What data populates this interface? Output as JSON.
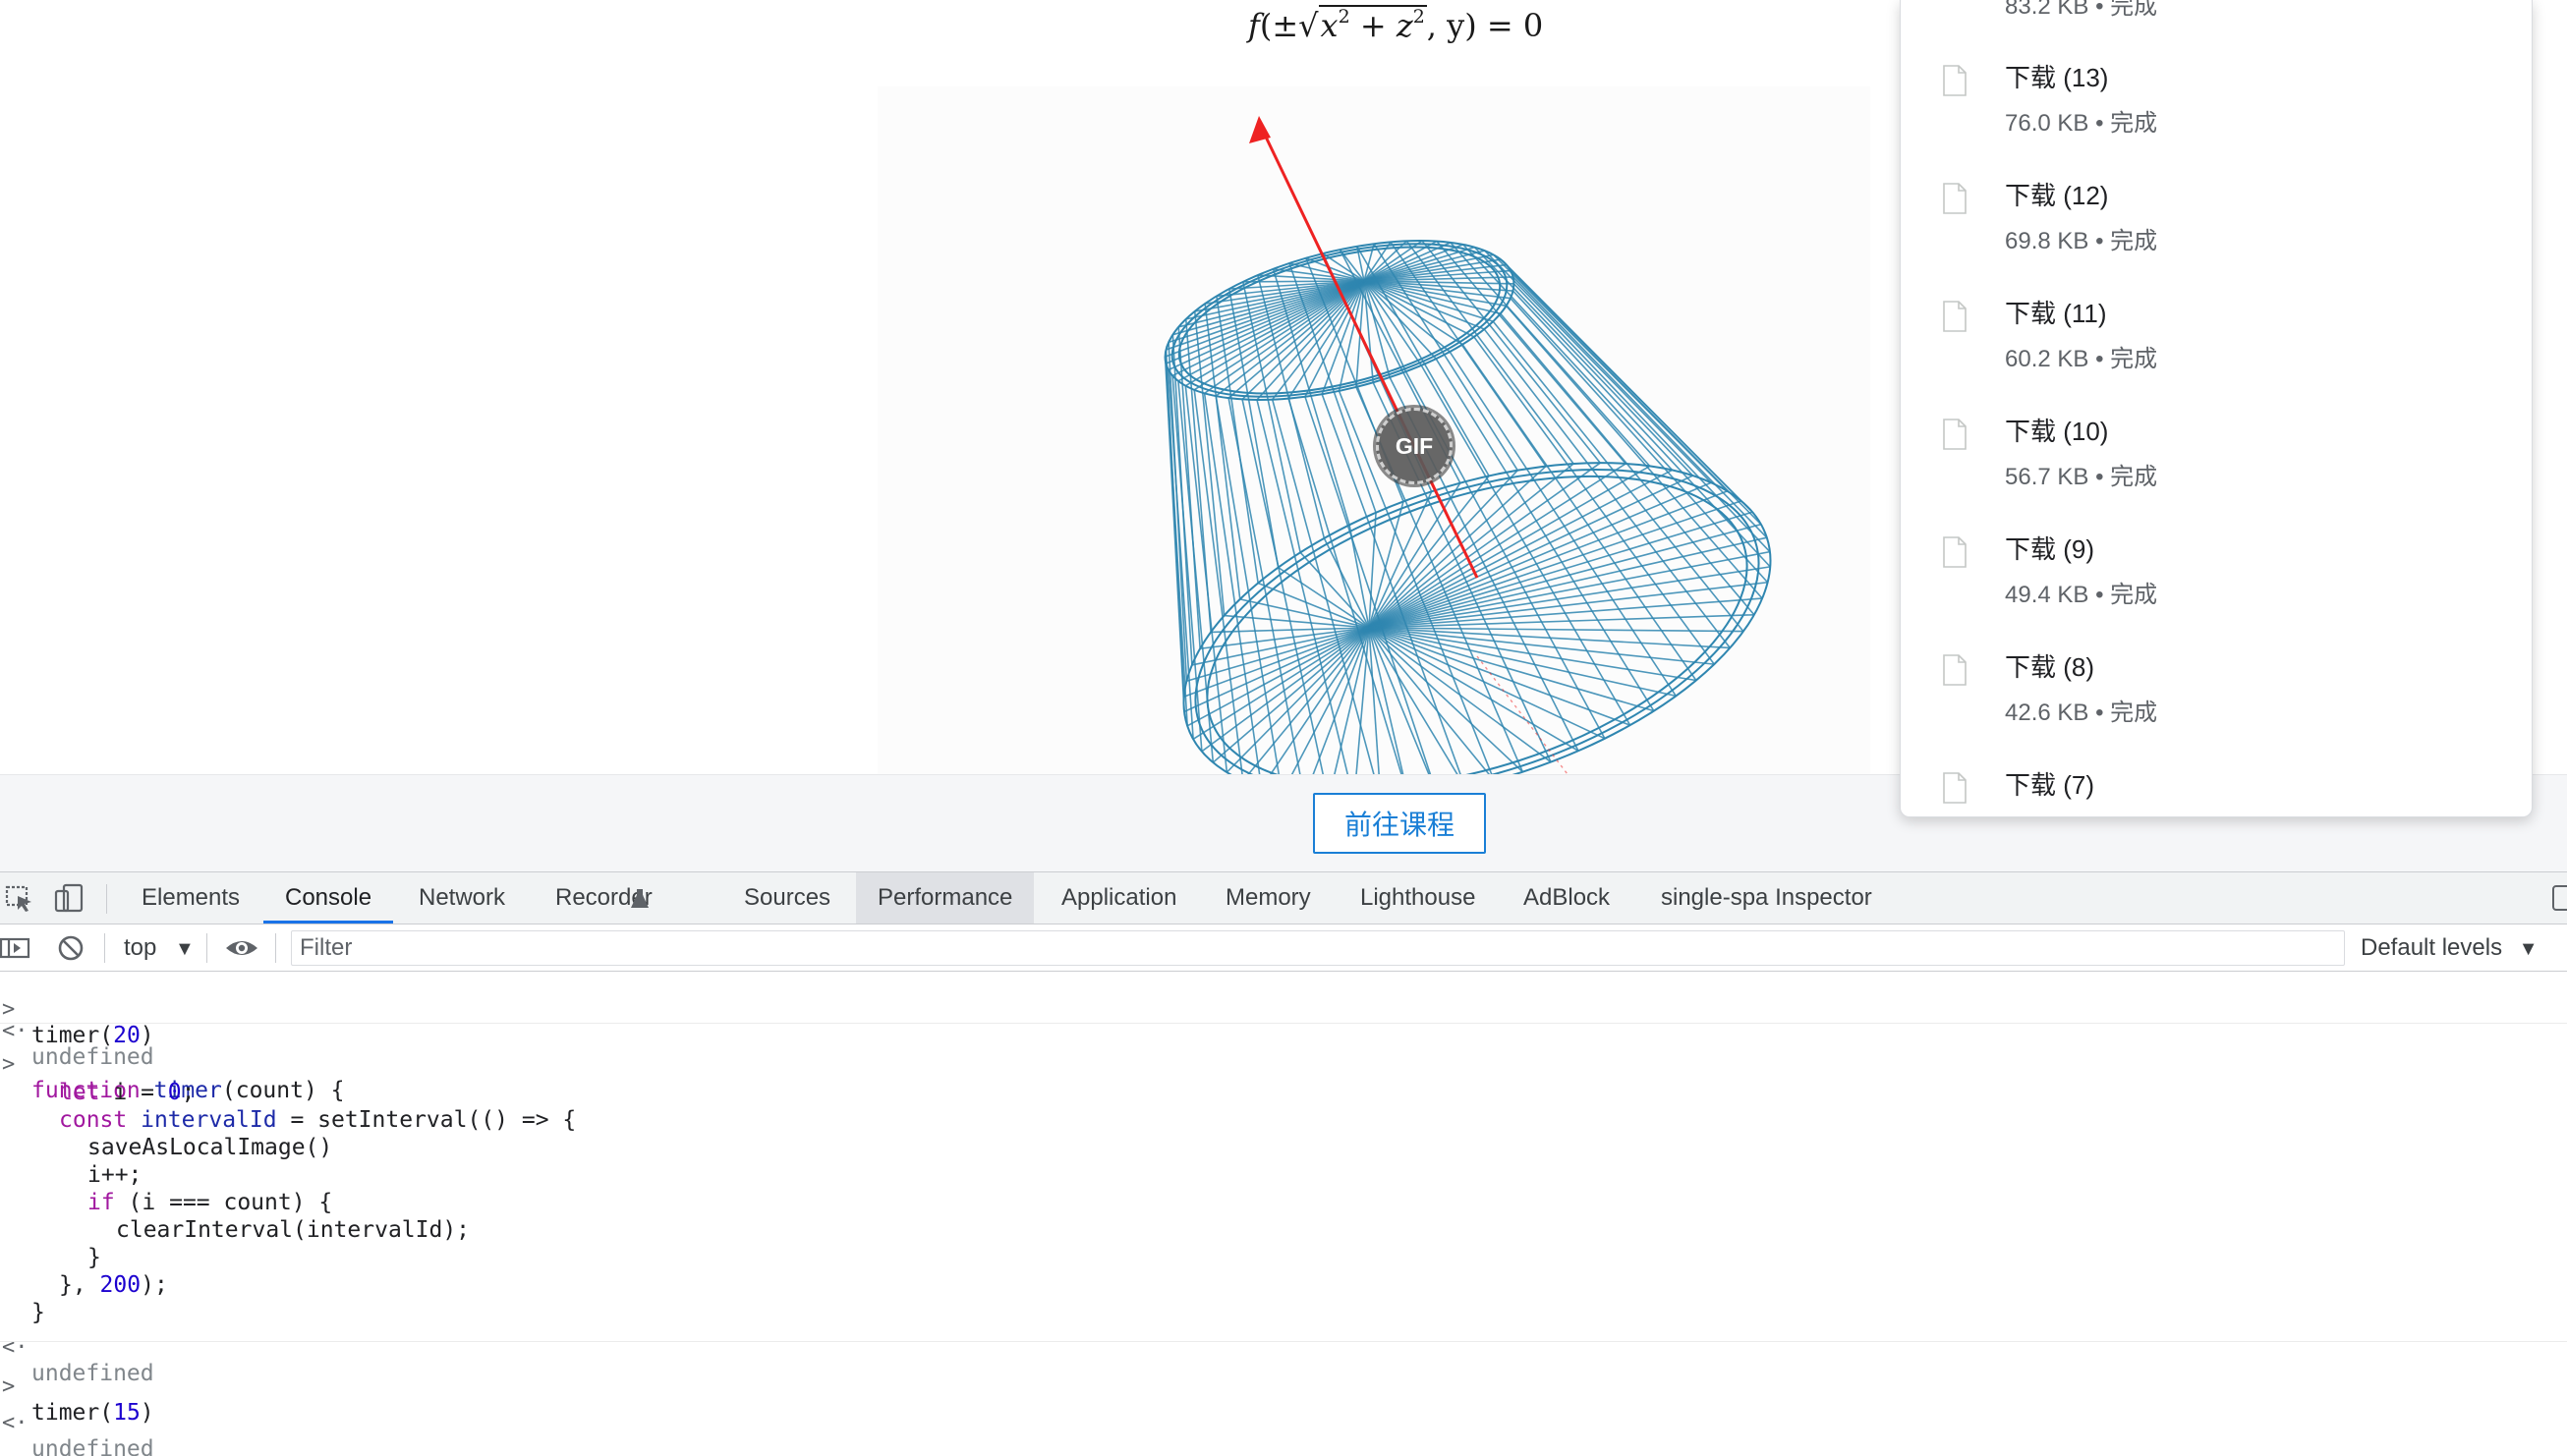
{
  "page": {
    "formula": {
      "f": "f",
      "open": "(±",
      "sqrt_sign": "√",
      "x": "x",
      "exp_x": "2",
      "plus": " + ",
      "z": "z",
      "exp_z": "2",
      "tail": ", y) = 0"
    },
    "gif_badge": "GIF",
    "course_button": "前往课程",
    "colors": {
      "mesh": "#2f86b0",
      "axis": "#ee2222",
      "button": "#1a7fd6"
    }
  },
  "downloads": {
    "top_partial_meta": "83.2 KB • 完成",
    "items": [
      {
        "name": "下载 (13)",
        "meta": "76.0 KB • 完成"
      },
      {
        "name": "下载 (12)",
        "meta": "69.8 KB • 完成"
      },
      {
        "name": "下载 (11)",
        "meta": "60.2 KB • 完成"
      },
      {
        "name": "下载 (10)",
        "meta": "56.7 KB • 完成"
      },
      {
        "name": "下载 (9)",
        "meta": "49.4 KB • 完成"
      },
      {
        "name": "下载 (8)",
        "meta": "42.6 KB • 完成"
      },
      {
        "name": "下载 (7)",
        "meta": ""
      }
    ],
    "icon": "file-icon"
  },
  "devtools": {
    "tabs": [
      "Elements",
      "Console",
      "Network",
      "Recorder",
      "Sources",
      "Performance",
      "Application",
      "Memory",
      "Lighthouse",
      "AdBlock",
      "single-spa Inspector"
    ],
    "active_tab": "Console",
    "context": "top",
    "filter_placeholder": "Filter",
    "levels": "Default levels",
    "console": {
      "prompt": ">",
      "result_arrow": "<·",
      "entry1": "timer(20)",
      "result1": "undefined",
      "code": {
        "l1_kw": "function",
        "l1_fn": "timer",
        "l1_rest": "(count) {",
        "l2_kw": "let",
        "l2_rest": " i = ",
        "l2_num": "0",
        "l2_end": ";",
        "l3_kw": "const",
        "l3_fn": "intervalId",
        "l3_rest": " = setInterval(() => {",
        "l4": "saveAsLocalImage()",
        "l5": "i++;",
        "l6_kw": "if",
        "l6_rest": " (i === count) {",
        "l7": "clearInterval(intervalId);",
        "l8": "}",
        "l9_start": "}, ",
        "l9_num": "200",
        "l9_end": ");",
        "l10": "}"
      },
      "result2": "undefined",
      "entry3_fn": "timer(",
      "entry3_num": "15",
      "entry3_end": ")",
      "result3": "undefined",
      "entry1_fn": "timer(",
      "entry1_num": "20",
      "entry1_end": ")"
    }
  }
}
